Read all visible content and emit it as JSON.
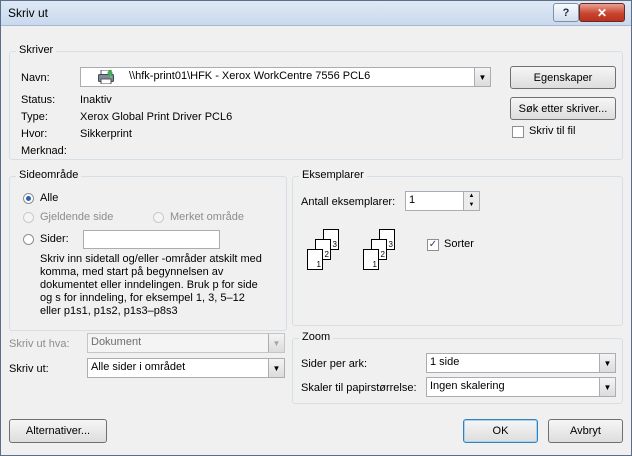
{
  "window": {
    "title": "Skriv ut"
  },
  "title_buttons": {
    "help": "?",
    "close": "✕"
  },
  "printer": {
    "legend": "Skriver",
    "name_label": "Navn:",
    "name_value": "\\\\hfk-print01\\HFK - Xerox WorkCentre 7556 PCL6",
    "status_label": "Status:",
    "status_value": "Inaktiv",
    "type_label": "Type:",
    "type_value": "Xerox Global Print Driver PCL6",
    "where_label": "Hvor:",
    "where_value": "Sikkerprint",
    "comment_label": "Merknad:",
    "comment_value": "",
    "properties_button": "Egenskaper",
    "find_printer_button": "Søk etter skriver...",
    "print_to_file_label": "Skriv til fil",
    "print_to_file_checked": false
  },
  "page_range": {
    "legend": "Sideområde",
    "all_label": "Alle",
    "current_label": "Gjeldende side",
    "selection_label": "Merket område",
    "pages_label": "Sider:",
    "pages_value": "",
    "selected": "all",
    "help_text": [
      "Skriv inn sidetall og/eller -områder atskilt med",
      "komma, med start på begynnelsen av",
      "dokumentet eller inndelingen. Bruk p for side",
      "og s for inndeling, for eksempel 1, 3, 5–12",
      "eller p1s1, p1s2, p1s3–p8s3"
    ]
  },
  "print_what": {
    "label": "Skriv ut hva:",
    "value": "Dokument"
  },
  "print": {
    "label": "Skriv ut:",
    "value": "Alle sider i området"
  },
  "copies": {
    "legend": "Eksemplarer",
    "count_label": "Antall eksemplarer:",
    "count_value": "1",
    "collate_label": "Sorter",
    "collate_checked": true,
    "stack_front": [
      "1",
      "2",
      "3"
    ],
    "stack_back": [
      "1",
      "2",
      "3"
    ]
  },
  "zoom": {
    "legend": "Zoom",
    "pages_per_sheet_label": "Sider per ark:",
    "pages_per_sheet_value": "1 side",
    "scale_label": "Skaler til papirstørrelse:",
    "scale_value": "Ingen skalering"
  },
  "footer": {
    "options_button": "Alternativer...",
    "ok_button": "OK",
    "cancel_button": "Avbryt"
  },
  "icons": {
    "printer": "printer-icon",
    "dropdown": "chevron-down-icon",
    "spin_up": "spin-up-icon",
    "spin_down": "spin-down-icon"
  },
  "colors": {
    "accent": "#2b62b4",
    "close": "#c9452f"
  }
}
